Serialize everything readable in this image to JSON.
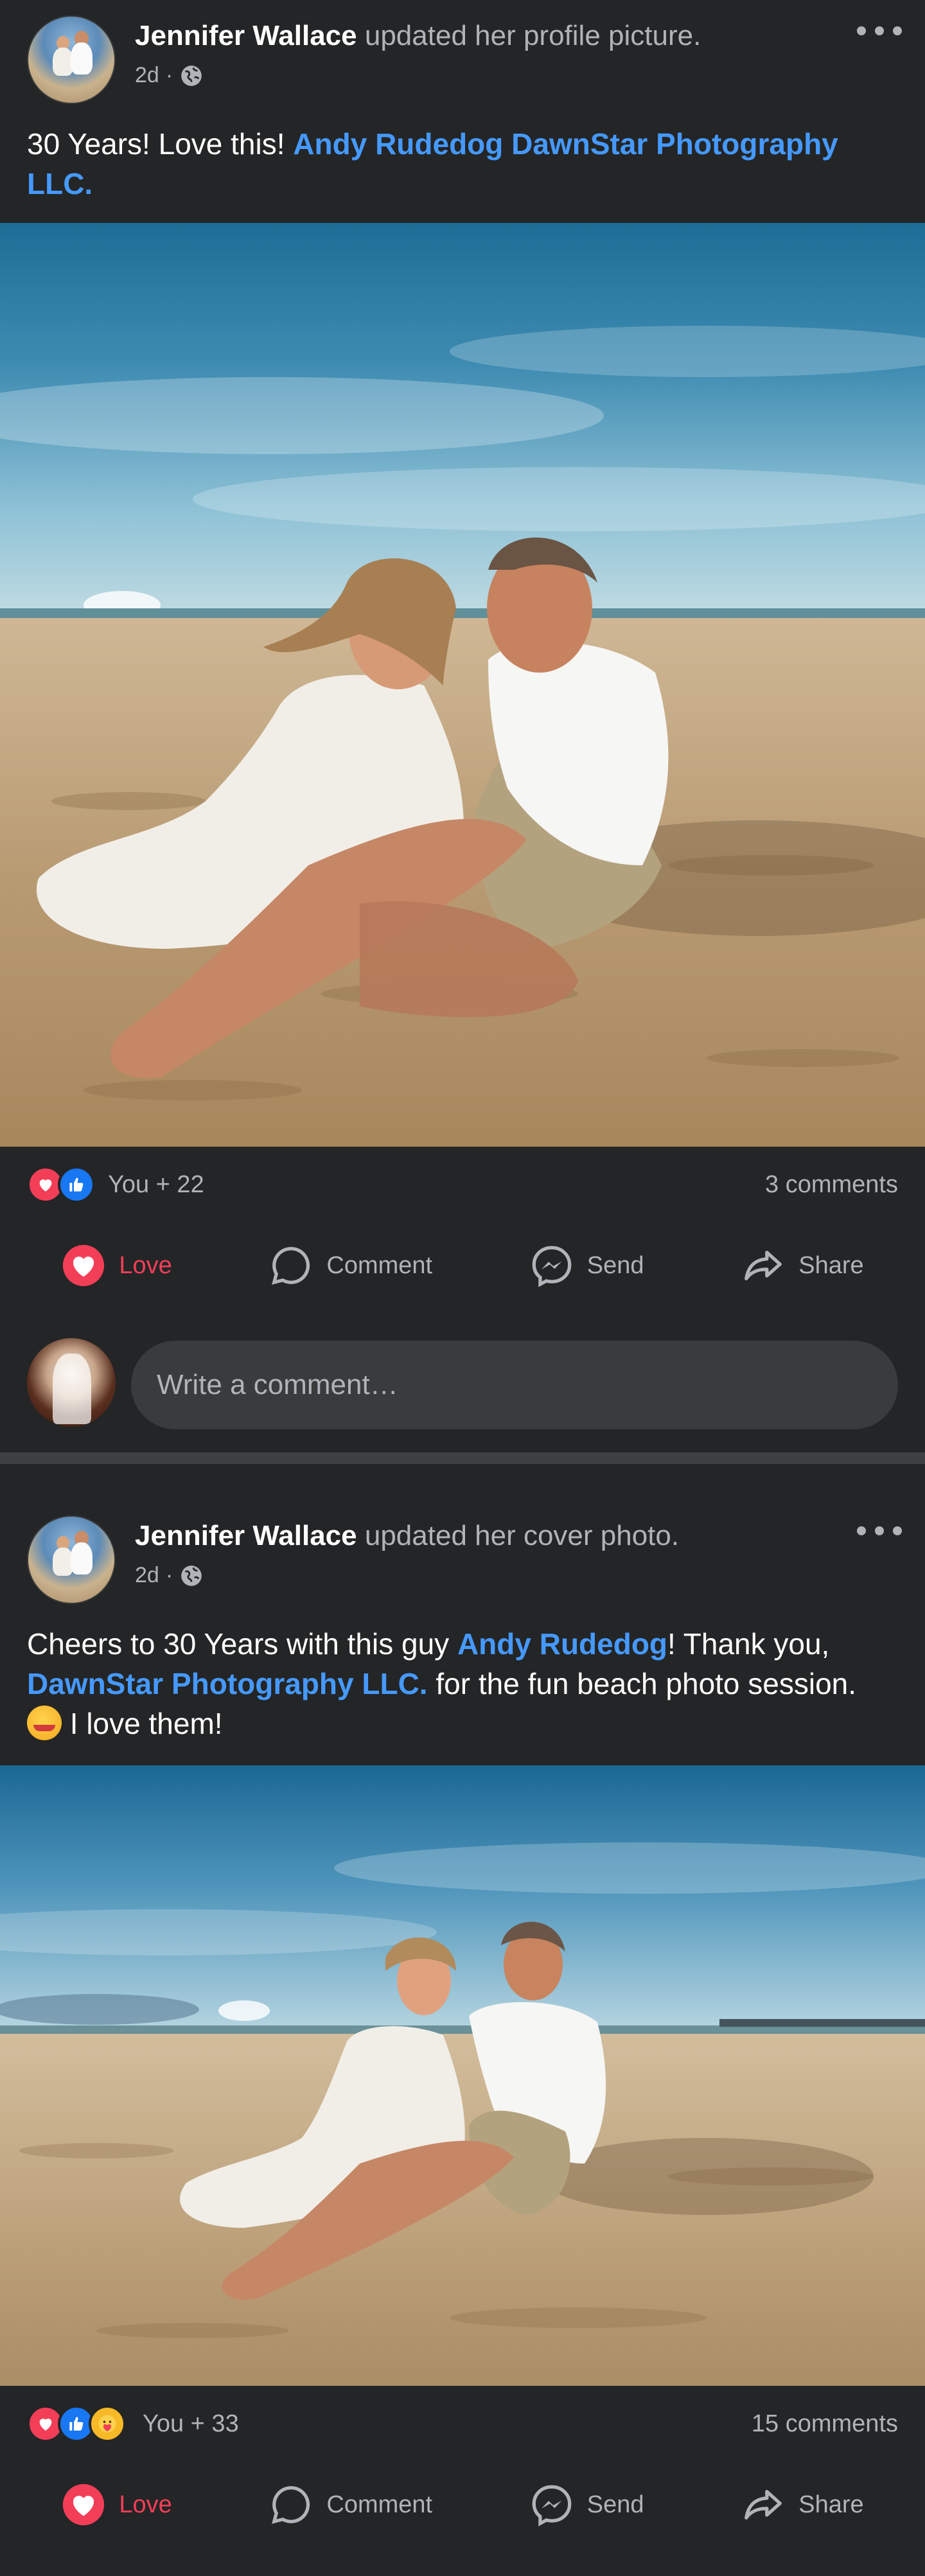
{
  "posts": [
    {
      "author": "Jennifer Wallace",
      "action": "updated her profile picture.",
      "time": "2d",
      "text_before": "30 Years! Love this! ",
      "link1": "Andy Rudedog DawnStar Photography LLC.",
      "reaction_summary": "You + 22",
      "comments": "3 comments",
      "actions": {
        "love": "Love",
        "comment": "Comment",
        "send": "Send",
        "share": "Share"
      },
      "comment_placeholder": "Write a comment…"
    },
    {
      "author": "Jennifer Wallace",
      "action": "updated her cover photo.",
      "time": "2d",
      "text_part1": "Cheers to 30 Years with this guy ",
      "link1": "Andy Rudedog",
      "text_part2": "! Thank you, ",
      "link2": "DawnStar Photography LLC.",
      "text_part3": " for the fun beach photo session.",
      "text_part4": " I love them!",
      "reaction_summary": "You + 33",
      "comments": "15 comments",
      "actions": {
        "love": "Love",
        "comment": "Comment",
        "send": "Send",
        "share": "Share"
      }
    }
  ],
  "colors": {
    "background": "#242526",
    "link": "#4599ff",
    "love": "#f33e58",
    "like": "#1877f2",
    "muted": "#b0b3b8"
  },
  "icons": [
    "globe-icon",
    "more-icon",
    "love-icon",
    "comment-icon",
    "messenger-icon",
    "share-icon"
  ]
}
